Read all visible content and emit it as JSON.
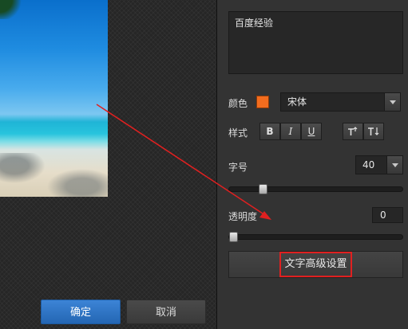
{
  "text_content": "百度经验",
  "color_label": "颜色",
  "color_value": "#f26c1e",
  "font_value": "宋体",
  "style_label": "样式",
  "style_buttons": {
    "bold": "B",
    "italic": "I",
    "underline": "U"
  },
  "size_label": "字号",
  "size_value": "40",
  "size_slider_fraction": 0.2,
  "opacity_label": "透明度",
  "opacity_value": "0",
  "opacity_slider_fraction": 0,
  "advanced_button": "文字高级设置",
  "confirm_button": "确定",
  "cancel_button": "取消",
  "accent_color": "#2a6fc0",
  "annotation_color": "#e02020",
  "icons": [
    "text-superscript-icon",
    "text-direction-icon",
    "chevron-down-icon"
  ]
}
